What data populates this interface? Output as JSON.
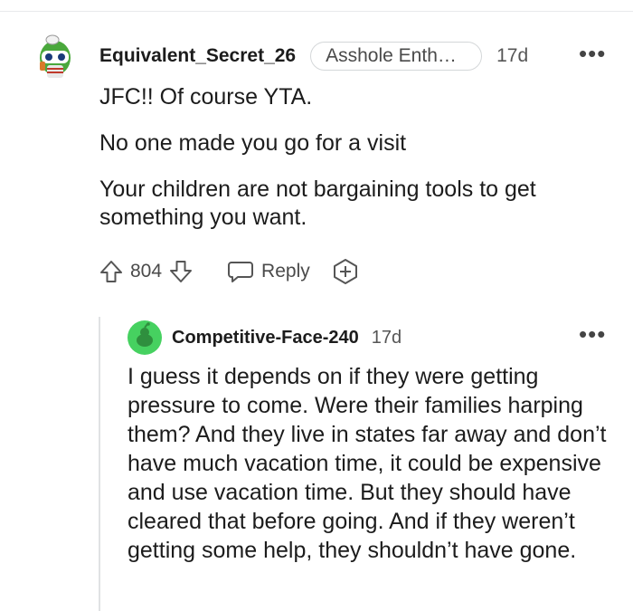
{
  "main_comment": {
    "username": "Equivalent_Secret_26",
    "flair": "Asshole Enthusi...",
    "age": "17d",
    "more": "•••",
    "paragraphs": [
      "JFC!! Of course YTA.",
      "No one made you go for a visit",
      "Your children are not bargaining tools to get something you want."
    ],
    "score": "804",
    "reply_label": "Reply"
  },
  "reply_comment": {
    "username": "Competitive-Face-240",
    "age": "17d",
    "more": "•••",
    "body": "I guess it depends on if they were getting pressure to come. Were their families harping them? And they live in states far away and don’t have much vacation time, it could be expensive and use vacation time. But they should have cleared that before going. And if they weren’t getting some help, they shouldn’t have gone."
  },
  "colors": {
    "text": "#1c1c1c",
    "meta": "#4a4a4a",
    "reply_avatar": "#46d160",
    "main_avatar_accent": "#4aa83c"
  }
}
